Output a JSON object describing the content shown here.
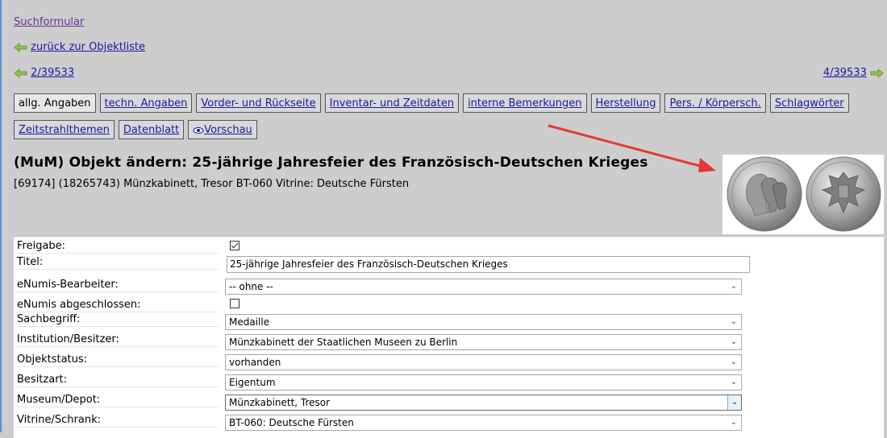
{
  "nav": {
    "suchformular": "Suchformular",
    "back_to_list": "zurück zur Objektliste",
    "prev": "2/39533",
    "next": "4/39533"
  },
  "tabs_row1": [
    {
      "label": "allg. Angaben",
      "active": true
    },
    {
      "label": "techn. Angaben"
    },
    {
      "label": "Vorder- und Rückseite"
    },
    {
      "label": "Inventar- und Zeitdaten"
    },
    {
      "label": "interne Bemerkungen"
    },
    {
      "label": "Herstellung"
    },
    {
      "label": "Pers. / Körpersch."
    },
    {
      "label": "Schlagwörter"
    }
  ],
  "tabs_row2": [
    {
      "label": "Zeitstrahlthemen"
    },
    {
      "label": "Datenblatt"
    },
    {
      "label": "Vorschau"
    }
  ],
  "page": {
    "title": "(MuM) Objekt ändern: 25-jährige Jahresfeier des Französisch-Deutschen Krieges",
    "subtitle": "[69174] (18265743) Münzkabinett, Tresor BT-060 Vitrine: Deutsche Fürsten"
  },
  "form": {
    "freigabe": {
      "label": "Freigabe:",
      "checked": true
    },
    "titel": {
      "label": "Titel:",
      "value": "25-jährige Jahresfeier des Französisch-Deutschen Krieges"
    },
    "bearbeiter": {
      "label": "eNumis-Bearbeiter:",
      "value": "-- ohne --"
    },
    "abgeschlossen": {
      "label": "eNumis abgeschlossen:",
      "checked": false
    },
    "sachbegriff": {
      "label": "Sachbegriff:",
      "value": "Medaille"
    },
    "institution": {
      "label": "Institution/Besitzer:",
      "value": "Münzkabinett der Staatlichen Museen zu Berlin"
    },
    "objektstatus": {
      "label": "Objektstatus:",
      "value": "vorhanden"
    },
    "besitzart": {
      "label": "Besitzart:",
      "value": "Eigentum"
    },
    "museum": {
      "label": "Museum/Depot:",
      "value": "Münzkabinett, Tresor"
    },
    "vitrine": {
      "label": "Vitrine/Schrank:",
      "value": "BT-060: Deutsche Fürsten"
    }
  },
  "colors": {
    "background": "#cdcdcd",
    "link": "#1a1aa6",
    "annotation_arrow": "#e53935"
  }
}
